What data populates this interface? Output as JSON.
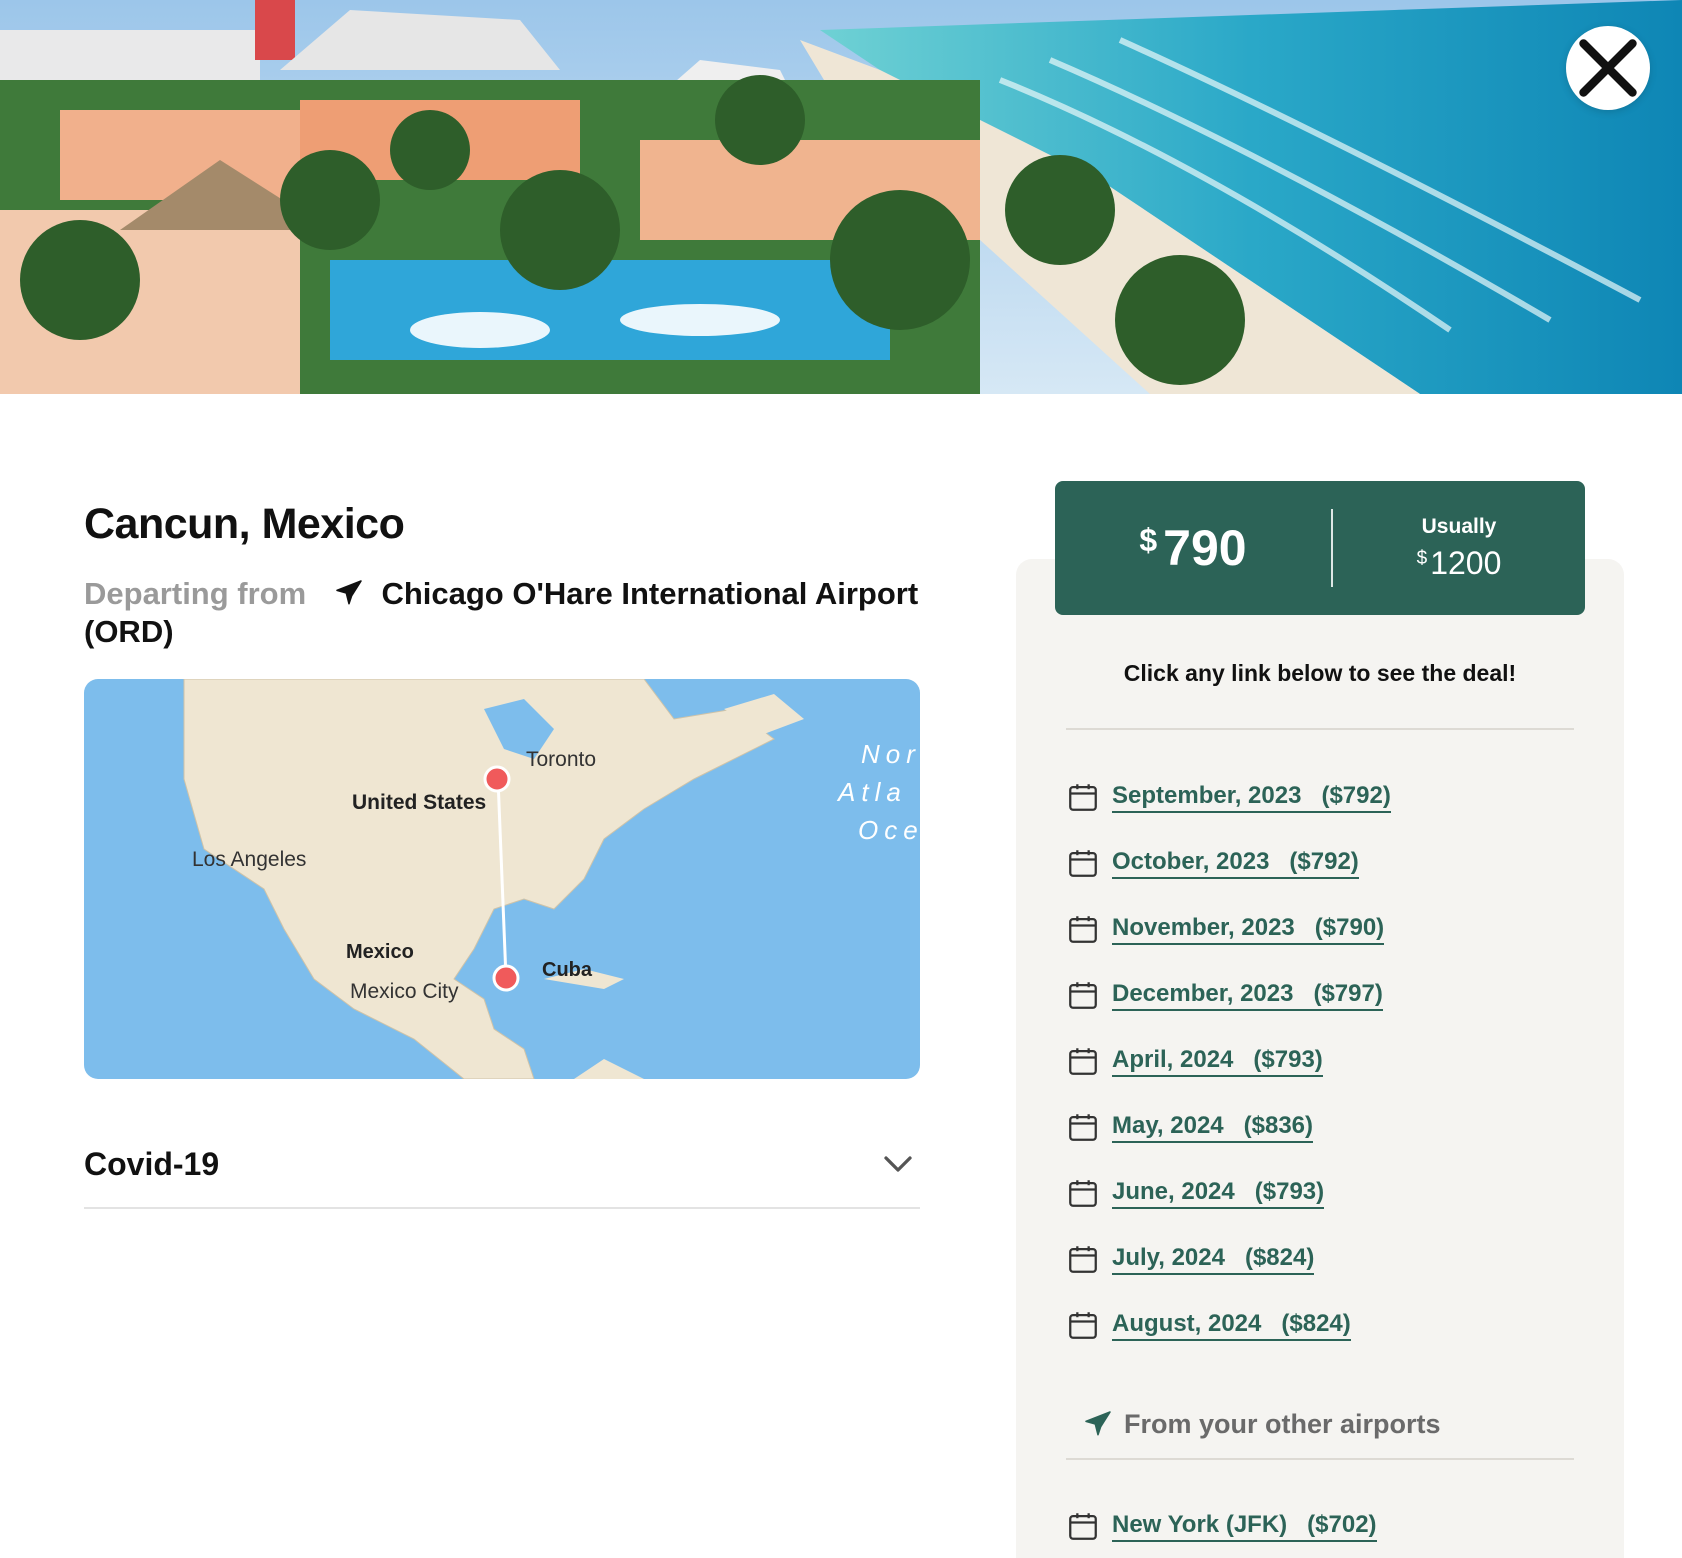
{
  "hero": {
    "close_icon": "close-icon"
  },
  "destination": {
    "title": "Cancun, Mexico",
    "departing_label": "Departing from",
    "departing_airport": "Chicago O'Hare International Airport (ORD)",
    "plane_icon": "plane-icon"
  },
  "map": {
    "labels": {
      "toronto": "Toronto",
      "united_states": "United States",
      "los_angeles": "Los Angeles",
      "mexico": "Mexico",
      "mexico_city": "Mexico City",
      "cuba": "Cuba",
      "ocean_line1": "Nor",
      "ocean_line2": "Atla",
      "ocean_line3": "Oce"
    },
    "route_color": "#ffffff",
    "pin_color": "#f05a5b",
    "water_color": "#7dbdec",
    "land_color": "#efe6d2"
  },
  "accordion": {
    "covid_label": "Covid-19",
    "chevron_icon": "chevron-down-icon"
  },
  "price": {
    "currency": "$",
    "current": "790",
    "usually_label": "Usually",
    "usual": "1200",
    "accent_color": "#2c6357"
  },
  "deals": {
    "hint": "Click any link below to see the deal!",
    "months": [
      {
        "label": "September, 2023",
        "price": "($792)"
      },
      {
        "label": "October, 2023",
        "price": "($792)"
      },
      {
        "label": "November, 2023",
        "price": "($790)"
      },
      {
        "label": "December, 2023",
        "price": "($797)"
      },
      {
        "label": "April, 2024",
        "price": "($793)"
      },
      {
        "label": "May, 2024",
        "price": "($836)"
      },
      {
        "label": "June, 2024",
        "price": "($793)"
      },
      {
        "label": "July, 2024",
        "price": "($824)"
      },
      {
        "label": "August, 2024",
        "price": "($824)"
      }
    ],
    "other_airports_label": "From your other airports",
    "airports": [
      {
        "label": "New York (JFK)",
        "price": "($702)"
      }
    ]
  }
}
